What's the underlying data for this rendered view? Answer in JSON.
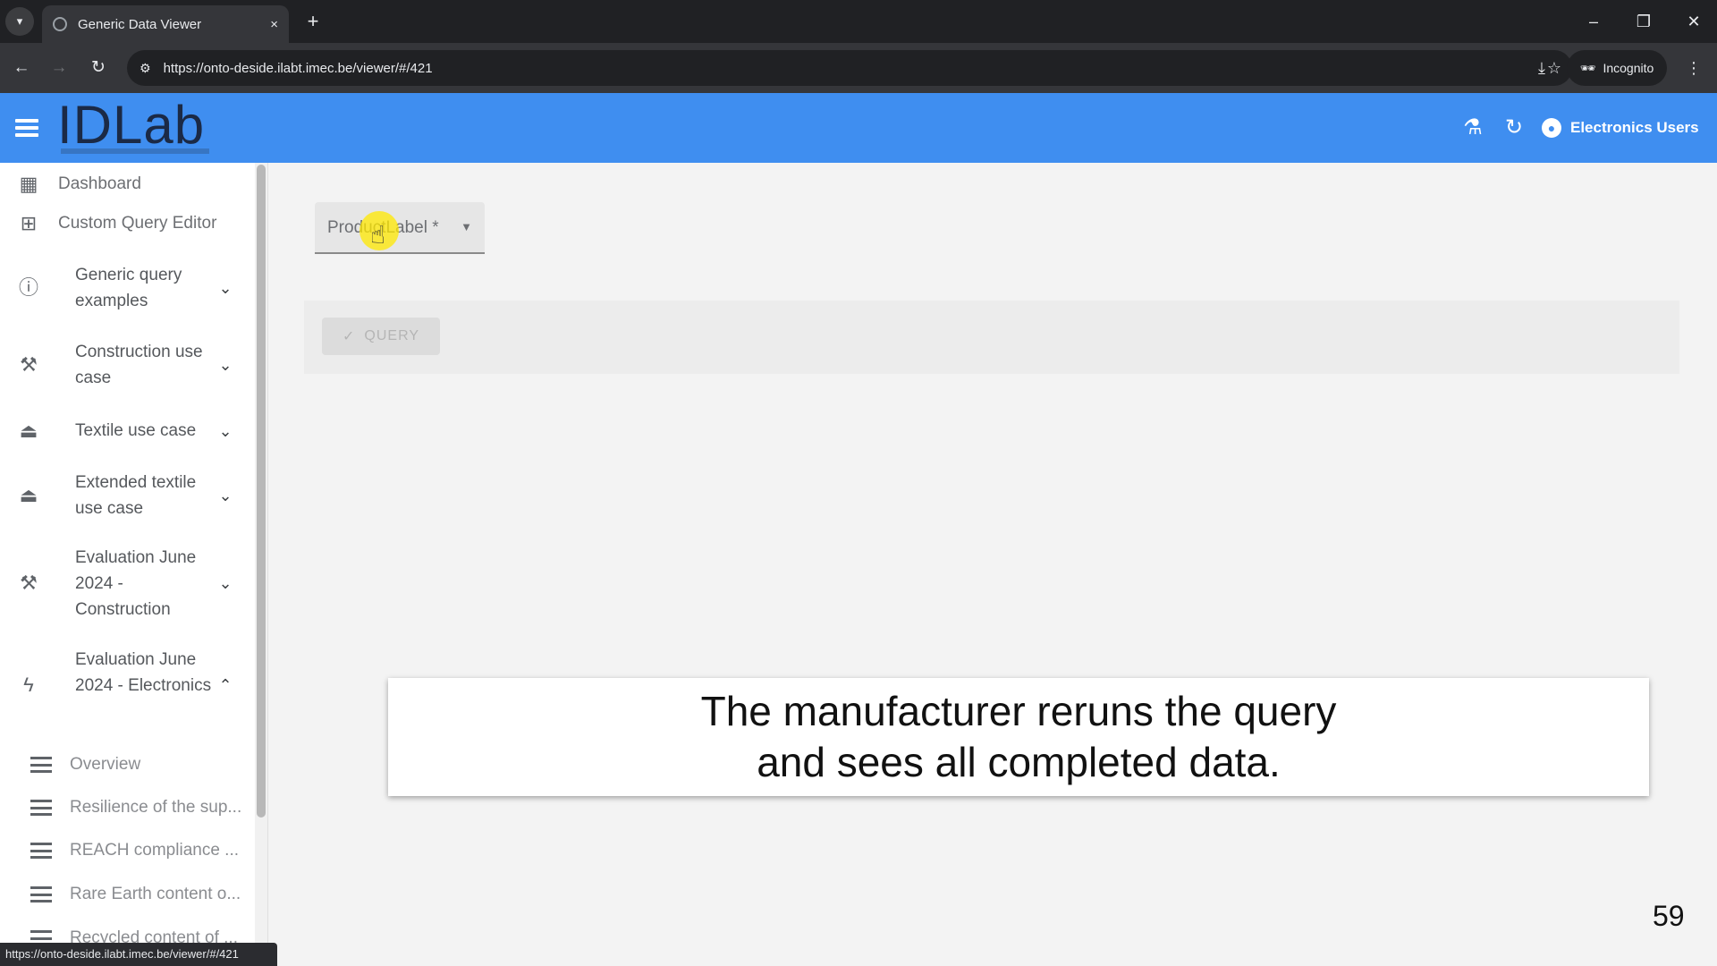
{
  "browser": {
    "tab_title": "Generic Data Viewer",
    "tab_close": "×",
    "new_tab": "+",
    "url": "https://onto-deside.ilabt.imec.be/viewer/#/421",
    "incognito_label": "Incognito",
    "status_url": "https://onto-deside.ilabt.imec.be/viewer/#/421"
  },
  "appbar": {
    "logo": "IDLab",
    "user_label": "Electronics Users"
  },
  "sidebar": {
    "top_items": [
      {
        "label": "Dashboard",
        "icon": "dashboard-icon"
      },
      {
        "label": "Custom Query Editor",
        "icon": "grid-add-icon"
      }
    ],
    "groups": [
      {
        "label": "Generic query examples",
        "icon": "info-icon",
        "expanded": false
      },
      {
        "label": "Construction use case",
        "icon": "tools-icon",
        "expanded": false
      },
      {
        "label": "Textile use case",
        "icon": "hanger-icon",
        "expanded": false
      },
      {
        "label": "Extended textile use case",
        "icon": "hanger-icon",
        "expanded": false
      },
      {
        "label": "Evaluation June 2024 - Construction",
        "icon": "tools-icon",
        "expanded": false
      },
      {
        "label": "Evaluation June 2024 - Electronics",
        "icon": "bolt-icon",
        "expanded": true
      }
    ],
    "sub_items": [
      {
        "label": "Overview"
      },
      {
        "label": "Resilience of the sup..."
      },
      {
        "label": "REACH compliance ..."
      },
      {
        "label": "Rare Earth content o..."
      },
      {
        "label": "Recycled content of ..."
      }
    ]
  },
  "main": {
    "select_label": "ProductLabel *",
    "query_button": "QUERY"
  },
  "caption": {
    "line1": "The manufacturer reruns the query",
    "line2": "and sees all completed data."
  },
  "page_number": "59",
  "colors": {
    "appbar": "#3f8ef0",
    "logo": "#1b2a46",
    "highlight": "#ffe800"
  }
}
